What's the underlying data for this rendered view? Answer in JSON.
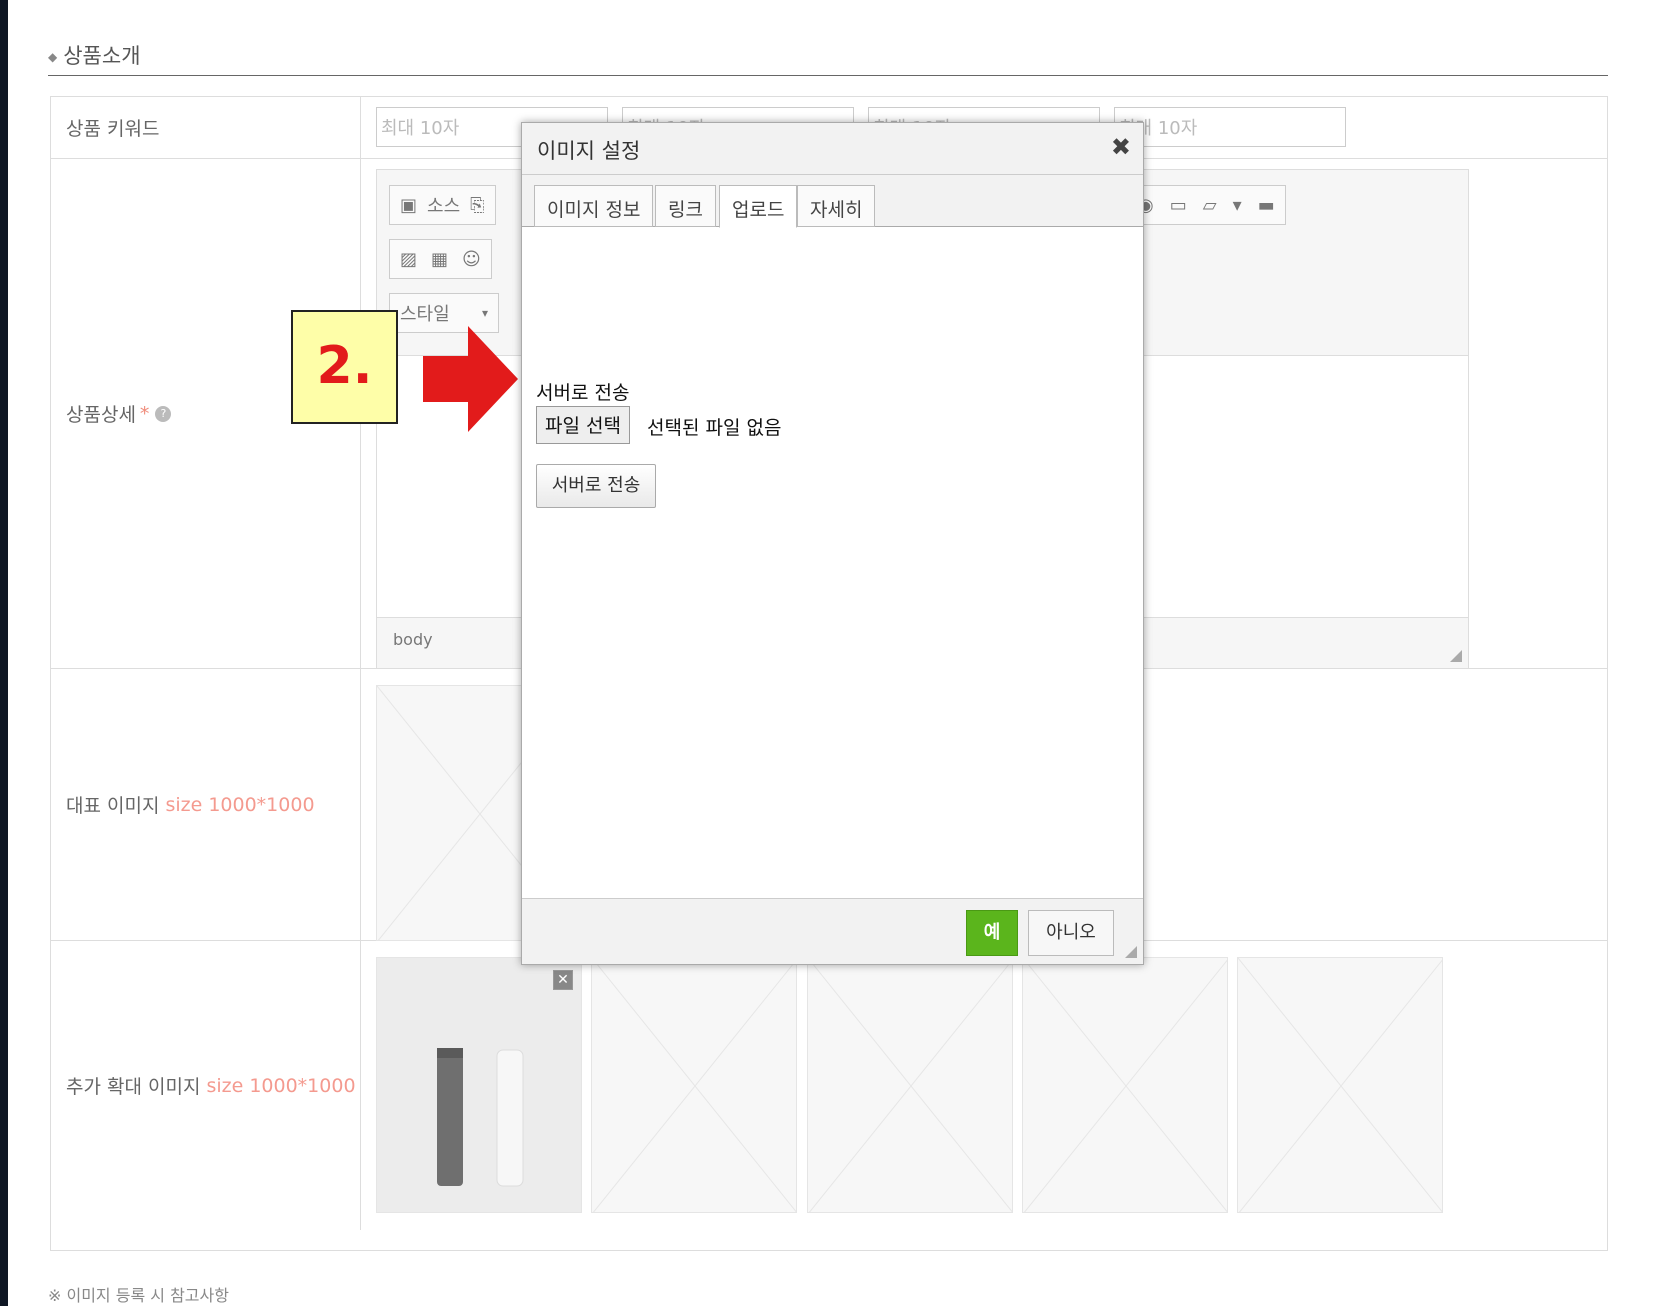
{
  "section": {
    "title": "상품소개",
    "bullet": "◆"
  },
  "rows": {
    "keyword": {
      "label": "상품 키워드",
      "placeholders": [
        "최대 10자",
        "최대 10자",
        "최대 10자",
        "최대 10자"
      ]
    },
    "detail": {
      "label": "상품상세",
      "required": "*",
      "help": "?"
    },
    "main_image": {
      "label": "대표 이미지",
      "hint": "size 1000*1000"
    },
    "extra_image": {
      "label": "추가 확대 이미지",
      "hint": "size 1000*1000",
      "remove": "✕"
    }
  },
  "editor": {
    "source_label": "소스",
    "style_label": "스타일",
    "status_path": "body"
  },
  "dialog": {
    "title": "이미지 설정",
    "close": "✖",
    "tabs": [
      "이미지 정보",
      "링크",
      "업로드",
      "자세히"
    ],
    "active_tab": "업로드",
    "send_label": "서버로 전송",
    "file_button": "파일 선택",
    "file_status": "선택된 파일 없음",
    "send_button": "서버로 전송",
    "ok_button": "예",
    "cancel_button": "아니오"
  },
  "annotation": {
    "step": "2."
  },
  "footer_note": "※ 이미지 등록 시 참고사항",
  "colors": {
    "accent_green": "#5bb51c",
    "annotation_red": "#e21b1b",
    "annotation_bg": "#fefea8",
    "hint_pink": "#f49a8f"
  }
}
